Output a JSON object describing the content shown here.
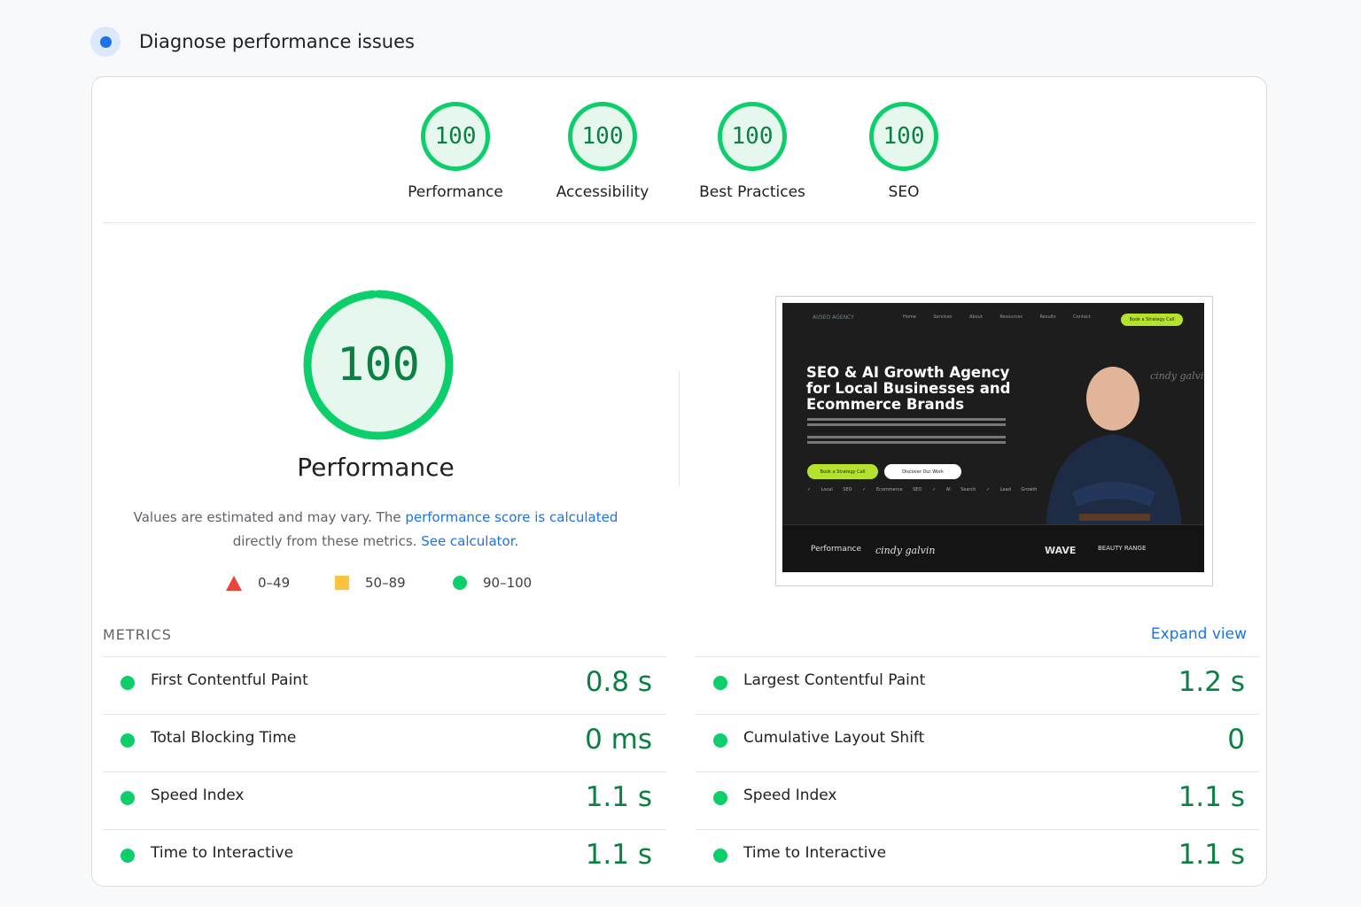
{
  "header": {
    "title": "Diagnose performance issues"
  },
  "categories": [
    {
      "score": "100",
      "label": "Performance"
    },
    {
      "score": "100",
      "label": "Accessibility"
    },
    {
      "score": "100",
      "label": "Best Practices"
    },
    {
      "score": "100",
      "label": "SEO"
    }
  ],
  "performance": {
    "score": "100",
    "score_fraction": 1.0,
    "label": "Performance",
    "desc_prefix": "Values are estimated and may vary. The ",
    "desc_link": "performance score is calculated",
    "desc_middle": "directly from these metrics. ",
    "desc_calc_link": "See calculator."
  },
  "legend": [
    {
      "shape": "triangle",
      "color": "#e8453c",
      "label": "0–49"
    },
    {
      "shape": "square",
      "color": "#ffc23d",
      "label": "50–89"
    },
    {
      "shape": "circle",
      "color": "#0cce6b",
      "label": "90–100"
    }
  ],
  "screenshot": {
    "nav_logo": "AI/SEO AGENCY",
    "nav_links": "Home Services About Resources Results Contact",
    "nav_cta": "Book a Strategy Call",
    "headline_1": "SEO & AI Growth Agency",
    "headline_2": "for Local Businesses and",
    "headline_3": "Ecommerce Brands",
    "btn_primary": "Book a Strategy Call",
    "btn_secondary": "Discover Our Work",
    "checks": "✓ Local SEO ✓ Ecommerce SEO ✓ AI Search ✓ Lead Growth",
    "client_logos": [
      "Performance",
      "cindy galvin",
      "WAVE",
      "BEAUTY RANGE"
    ]
  },
  "metrics": {
    "title": "METRICS",
    "expand_label": "Expand view",
    "left": [
      {
        "name": "First Contentful Paint",
        "value": "0.8 s"
      },
      {
        "name": "Total Blocking Time",
        "value": "0 ms"
      },
      {
        "name": "Speed Index",
        "value": "1.1 s"
      },
      {
        "name": "Time to Interactive",
        "value": "1.1 s"
      }
    ],
    "right": [
      {
        "name": "Largest Contentful Paint",
        "value": "1.2 s"
      },
      {
        "name": "Cumulative Layout Shift",
        "value": "0"
      },
      {
        "name": "Speed Index",
        "value": "1.1 s"
      },
      {
        "name": "Time to Interactive",
        "value": "1.1 s"
      }
    ]
  },
  "colors": {
    "pass": "#0cce6b",
    "pass_text": "#0b8043",
    "link": "#1a73e8"
  }
}
